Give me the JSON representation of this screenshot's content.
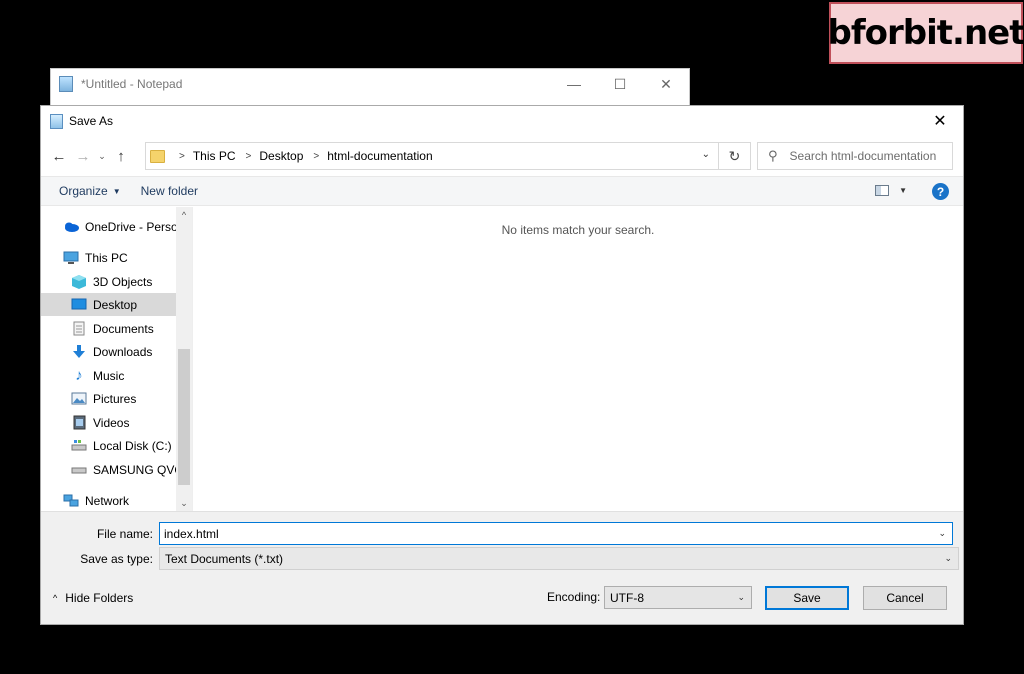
{
  "watermark": "bforbit.net",
  "notepad": {
    "title": "*Untitled - Notepad",
    "minimize": "—",
    "maximize": "☐",
    "close": "✕"
  },
  "dialog": {
    "title": "Save As",
    "close": "✕"
  },
  "nav": {
    "back": "←",
    "forward": "→",
    "recent": "⌄",
    "up": "↑",
    "breadcrumbs": [
      "This PC",
      "Desktop",
      "html-documentation"
    ],
    "dropdown": "⌄",
    "refresh": "↻",
    "search_placeholder": "Search html-documentation"
  },
  "toolbar": {
    "organize": "Organize",
    "new_folder": "New folder",
    "help": "?"
  },
  "sidebar": {
    "scroll_up": "^",
    "scroll_down": "⌄",
    "items": [
      {
        "label": "OneDrive - Personal",
        "icon": "cloud-icon"
      },
      {
        "label": "This PC",
        "icon": "computer-icon"
      },
      {
        "label": "3D Objects",
        "icon": "cube-icon"
      },
      {
        "label": "Desktop",
        "icon": "desktop-icon",
        "selected": true
      },
      {
        "label": "Documents",
        "icon": "document-icon"
      },
      {
        "label": "Downloads",
        "icon": "download-icon"
      },
      {
        "label": "Music",
        "icon": "music-icon"
      },
      {
        "label": "Pictures",
        "icon": "picture-icon"
      },
      {
        "label": "Videos",
        "icon": "video-icon"
      },
      {
        "label": "Local Disk (C:)",
        "icon": "disk-icon"
      },
      {
        "label": "SAMSUNG QVO",
        "icon": "drive-icon"
      },
      {
        "label": "Network",
        "icon": "network-icon"
      }
    ]
  },
  "content": {
    "empty_message": "No items match your search."
  },
  "form": {
    "filename_label": "File name:",
    "filename_value": "index.html",
    "savetype_label": "Save as type:",
    "savetype_value": "Text Documents (*.txt)",
    "encoding_label": "Encoding:",
    "encoding_value": "UTF-8",
    "dropdown": "⌄"
  },
  "footer": {
    "hide_folders": "Hide Folders",
    "hide_chevron": "^",
    "save": "Save",
    "cancel": "Cancel"
  },
  "colors": {
    "accent": "#0078d7",
    "help": "#1a73c8",
    "folder": "#f5d36b",
    "selected": "#d9d9d9",
    "watermark_bg": "#f6d3d6"
  }
}
